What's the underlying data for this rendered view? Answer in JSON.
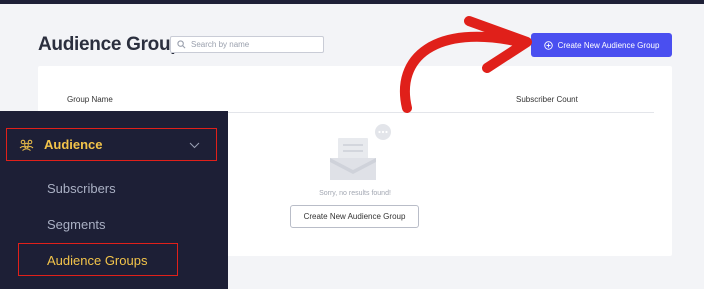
{
  "header": {
    "title": "Audience Groups",
    "search_placeholder": "Search by name",
    "create_button_label": "Create New Audience Group"
  },
  "table": {
    "columns": [
      "Group Name",
      "Subscriber Count"
    ]
  },
  "empty_state": {
    "message": "Sorry, no results found!",
    "button_label": "Create New Audience Group"
  },
  "sidebar": {
    "section_label": "Audience",
    "items": [
      {
        "label": "Subscribers"
      },
      {
        "label": "Segments"
      },
      {
        "label": "Audience Groups",
        "active": true
      }
    ]
  },
  "colors": {
    "primary_button": "#4a4ff0",
    "sidebar_bg": "#1d1f36",
    "sidebar_accent": "#f3c44a",
    "annotation_red": "#e0201a"
  },
  "icons": {
    "search": "search-icon",
    "add": "plus-circle-icon",
    "audience": "audience-icon",
    "chevron": "chevron-down-icon",
    "empty_state": "empty-inbox-illustration",
    "annotation": "red-arrow-annotation"
  }
}
